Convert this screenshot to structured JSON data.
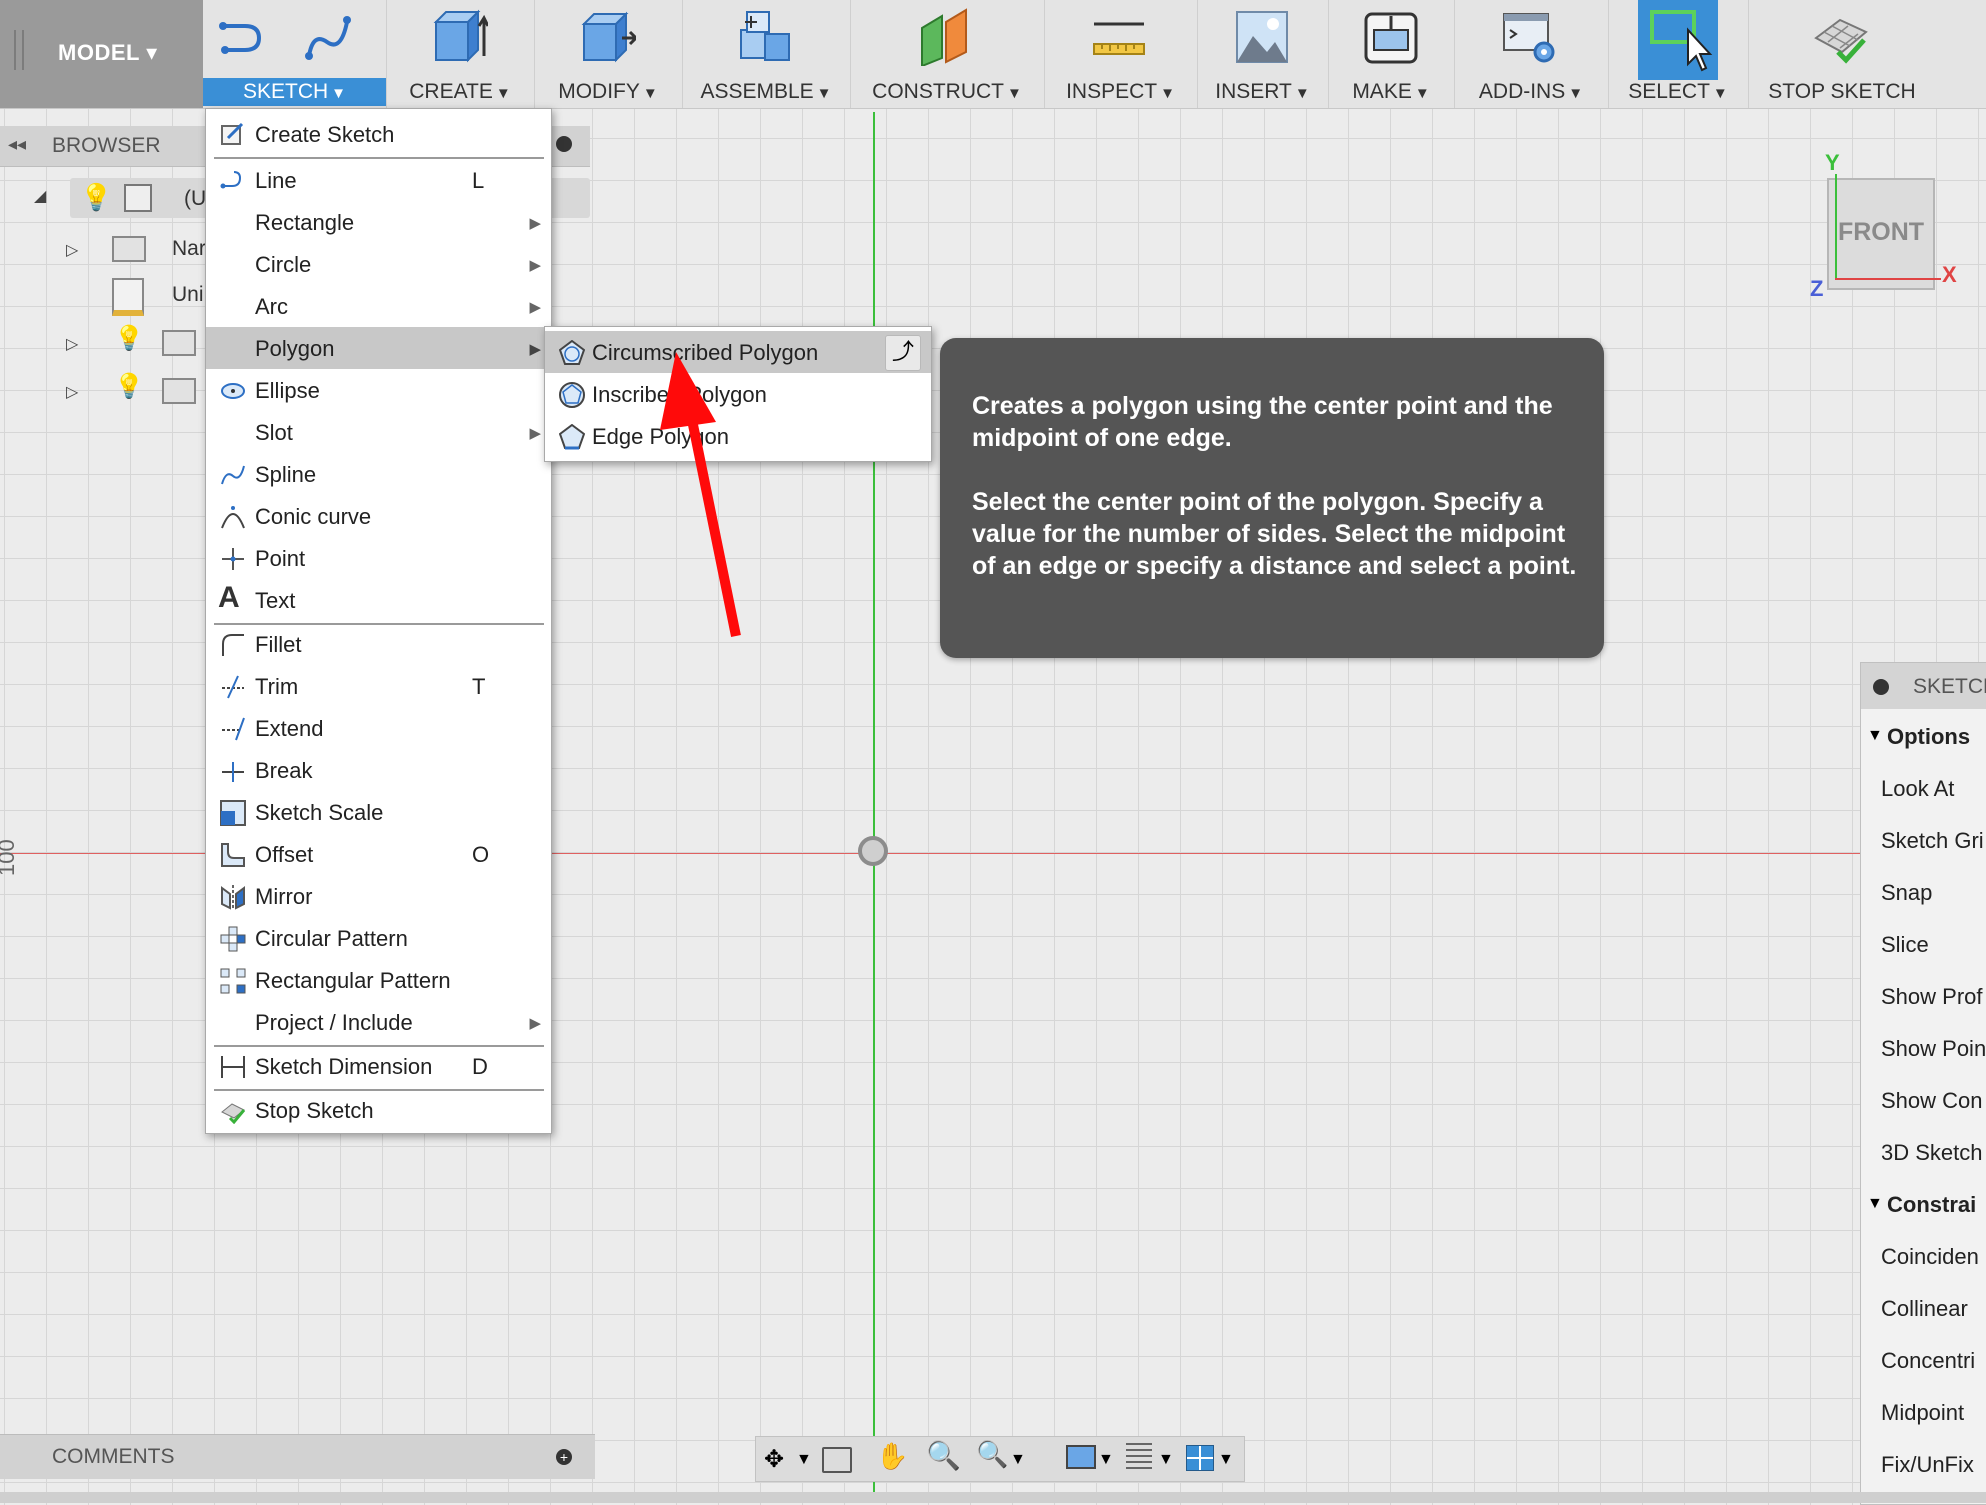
{
  "toolbar": {
    "model_label": "MODEL",
    "groups": [
      {
        "label": "SKETCH"
      },
      {
        "label": "CREATE"
      },
      {
        "label": "MODIFY"
      },
      {
        "label": "ASSEMBLE"
      },
      {
        "label": "CONSTRUCT"
      },
      {
        "label": "INSPECT"
      },
      {
        "label": "INSERT"
      },
      {
        "label": "MAKE"
      },
      {
        "label": "ADD-INS"
      },
      {
        "label": "SELECT"
      }
    ],
    "stop_sketch_label": "STOP SKETCH",
    "accent_color": "#3a8fd6"
  },
  "browser": {
    "title": "BROWSER",
    "rows": [
      {
        "text": "(U"
      },
      {
        "text": "Nar"
      },
      {
        "text": "Uni"
      },
      {
        "text": ""
      },
      {
        "text": ""
      }
    ]
  },
  "sketch_menu": {
    "items": [
      {
        "label": "Create Sketch",
        "shortcut": ""
      },
      {
        "label": "Line",
        "shortcut": "L"
      },
      {
        "label": "Rectangle",
        "shortcut": ""
      },
      {
        "label": "Circle",
        "shortcut": ""
      },
      {
        "label": "Arc",
        "shortcut": ""
      },
      {
        "label": "Polygon",
        "shortcut": ""
      },
      {
        "label": "Ellipse",
        "shortcut": ""
      },
      {
        "label": "Slot",
        "shortcut": ""
      },
      {
        "label": "Spline",
        "shortcut": ""
      },
      {
        "label": "Conic curve",
        "shortcut": ""
      },
      {
        "label": "Point",
        "shortcut": ""
      },
      {
        "label": "Text",
        "shortcut": ""
      },
      {
        "label": "Fillet",
        "shortcut": ""
      },
      {
        "label": "Trim",
        "shortcut": "T"
      },
      {
        "label": "Extend",
        "shortcut": ""
      },
      {
        "label": "Break",
        "shortcut": ""
      },
      {
        "label": "Sketch Scale",
        "shortcut": ""
      },
      {
        "label": "Offset",
        "shortcut": "O"
      },
      {
        "label": "Mirror",
        "shortcut": ""
      },
      {
        "label": "Circular Pattern",
        "shortcut": ""
      },
      {
        "label": "Rectangular Pattern",
        "shortcut": ""
      },
      {
        "label": "Project / Include",
        "shortcut": ""
      },
      {
        "label": "Sketch Dimension",
        "shortcut": "D"
      },
      {
        "label": "Stop Sketch",
        "shortcut": ""
      }
    ]
  },
  "polygon_menu": {
    "items": [
      {
        "label": "Circumscribed Polygon"
      },
      {
        "label": "Inscribed Polygon"
      },
      {
        "label": "Edge Polygon"
      }
    ]
  },
  "tooltip": {
    "line1": "Creates a polygon using the center point and the midpoint of one edge.",
    "line2": "Select the center point of the polygon. Specify a value for the number of sides. Select the midpoint of an edge or specify a distance and select a point."
  },
  "viewcube": {
    "face": "FRONT",
    "axis_y": "Y",
    "axis_x": "X",
    "axis_z": "Z"
  },
  "canvas": {
    "ruler_label": "100"
  },
  "sketch_palette": {
    "title": "SKETCH",
    "options_header": "Options",
    "options": [
      "Look At",
      "Sketch Gri",
      "Snap",
      "Slice",
      "Show Prof",
      "Show Poin",
      "Show Con",
      "3D Sketch"
    ],
    "constraints_header": "Constrai",
    "constraints": [
      "Coinciden",
      "Collinear",
      "Concentri",
      "Midpoint",
      "Fix/UnFix"
    ]
  },
  "comments": {
    "title": "COMMENTS"
  }
}
